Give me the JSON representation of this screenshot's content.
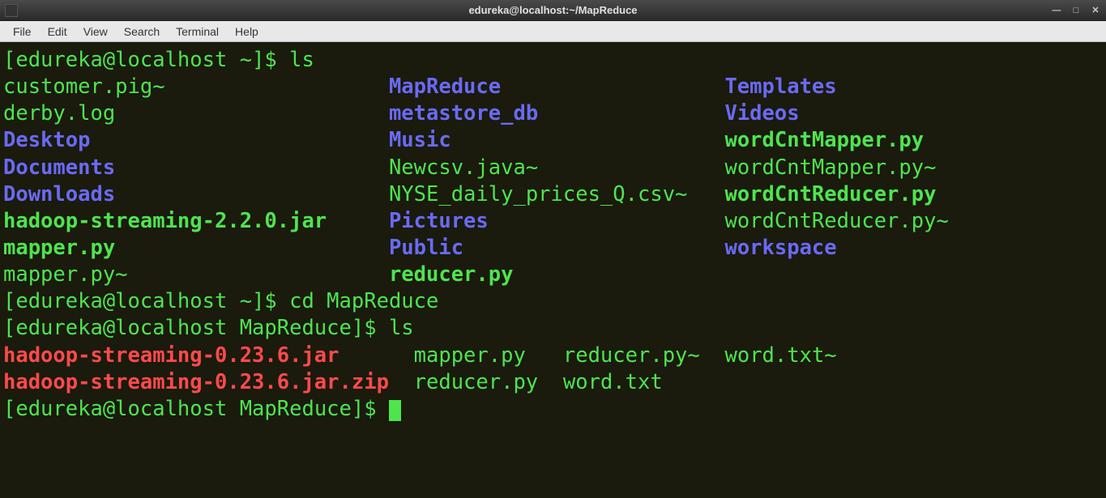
{
  "window": {
    "title": "edureka@localhost:~/MapReduce"
  },
  "menubar": {
    "items": [
      "File",
      "Edit",
      "View",
      "Search",
      "Terminal",
      "Help"
    ]
  },
  "prompts": {
    "p1_user": "[edureka@localhost ",
    "p1_path": "~",
    "p1_end": "]$ ",
    "p2_user": "[edureka@localhost ",
    "p2_path": "~",
    "p2_end": "]$ ",
    "p3_user": "[edureka@localhost ",
    "p3_path": "MapReduce",
    "p3_end": "]$ ",
    "p4_user": "[edureka@localhost ",
    "p4_path": "MapReduce",
    "p4_end": "]$ "
  },
  "commands": {
    "c1": "ls",
    "c2": "cd MapReduce",
    "c3": "ls"
  },
  "ls1": {
    "col1": {
      "r1": "customer.pig~",
      "r2": "derby.log",
      "r3": "Desktop",
      "r4": "Documents",
      "r5": "Downloads",
      "r6": "hadoop-streaming-2.2.0.jar",
      "r7": "mapper.py",
      "r8": "mapper.py~"
    },
    "col2": {
      "r1": "MapReduce",
      "r2": "metastore_db",
      "r3": "Music",
      "r4": "Newcsv.java~",
      "r5": "NYSE_daily_prices_Q.csv~",
      "r6": "Pictures",
      "r7": "Public",
      "r8": "reducer.py"
    },
    "col3": {
      "r1": "Templates",
      "r2": "Videos",
      "r3": "wordCntMapper.py",
      "r4": "wordCntMapper.py~",
      "r5": "wordCntReducer.py",
      "r6": "wordCntReducer.py~",
      "r7": "workspace"
    }
  },
  "ls2": {
    "row1": {
      "c1": "hadoop-streaming-0.23.6.jar",
      "c2": "mapper.py",
      "c3": "reducer.py~",
      "c4": "word.txt~"
    },
    "row2": {
      "c1": "hadoop-streaming-0.23.6.jar.zip",
      "c2": "reducer.py",
      "c3": "word.txt"
    }
  }
}
